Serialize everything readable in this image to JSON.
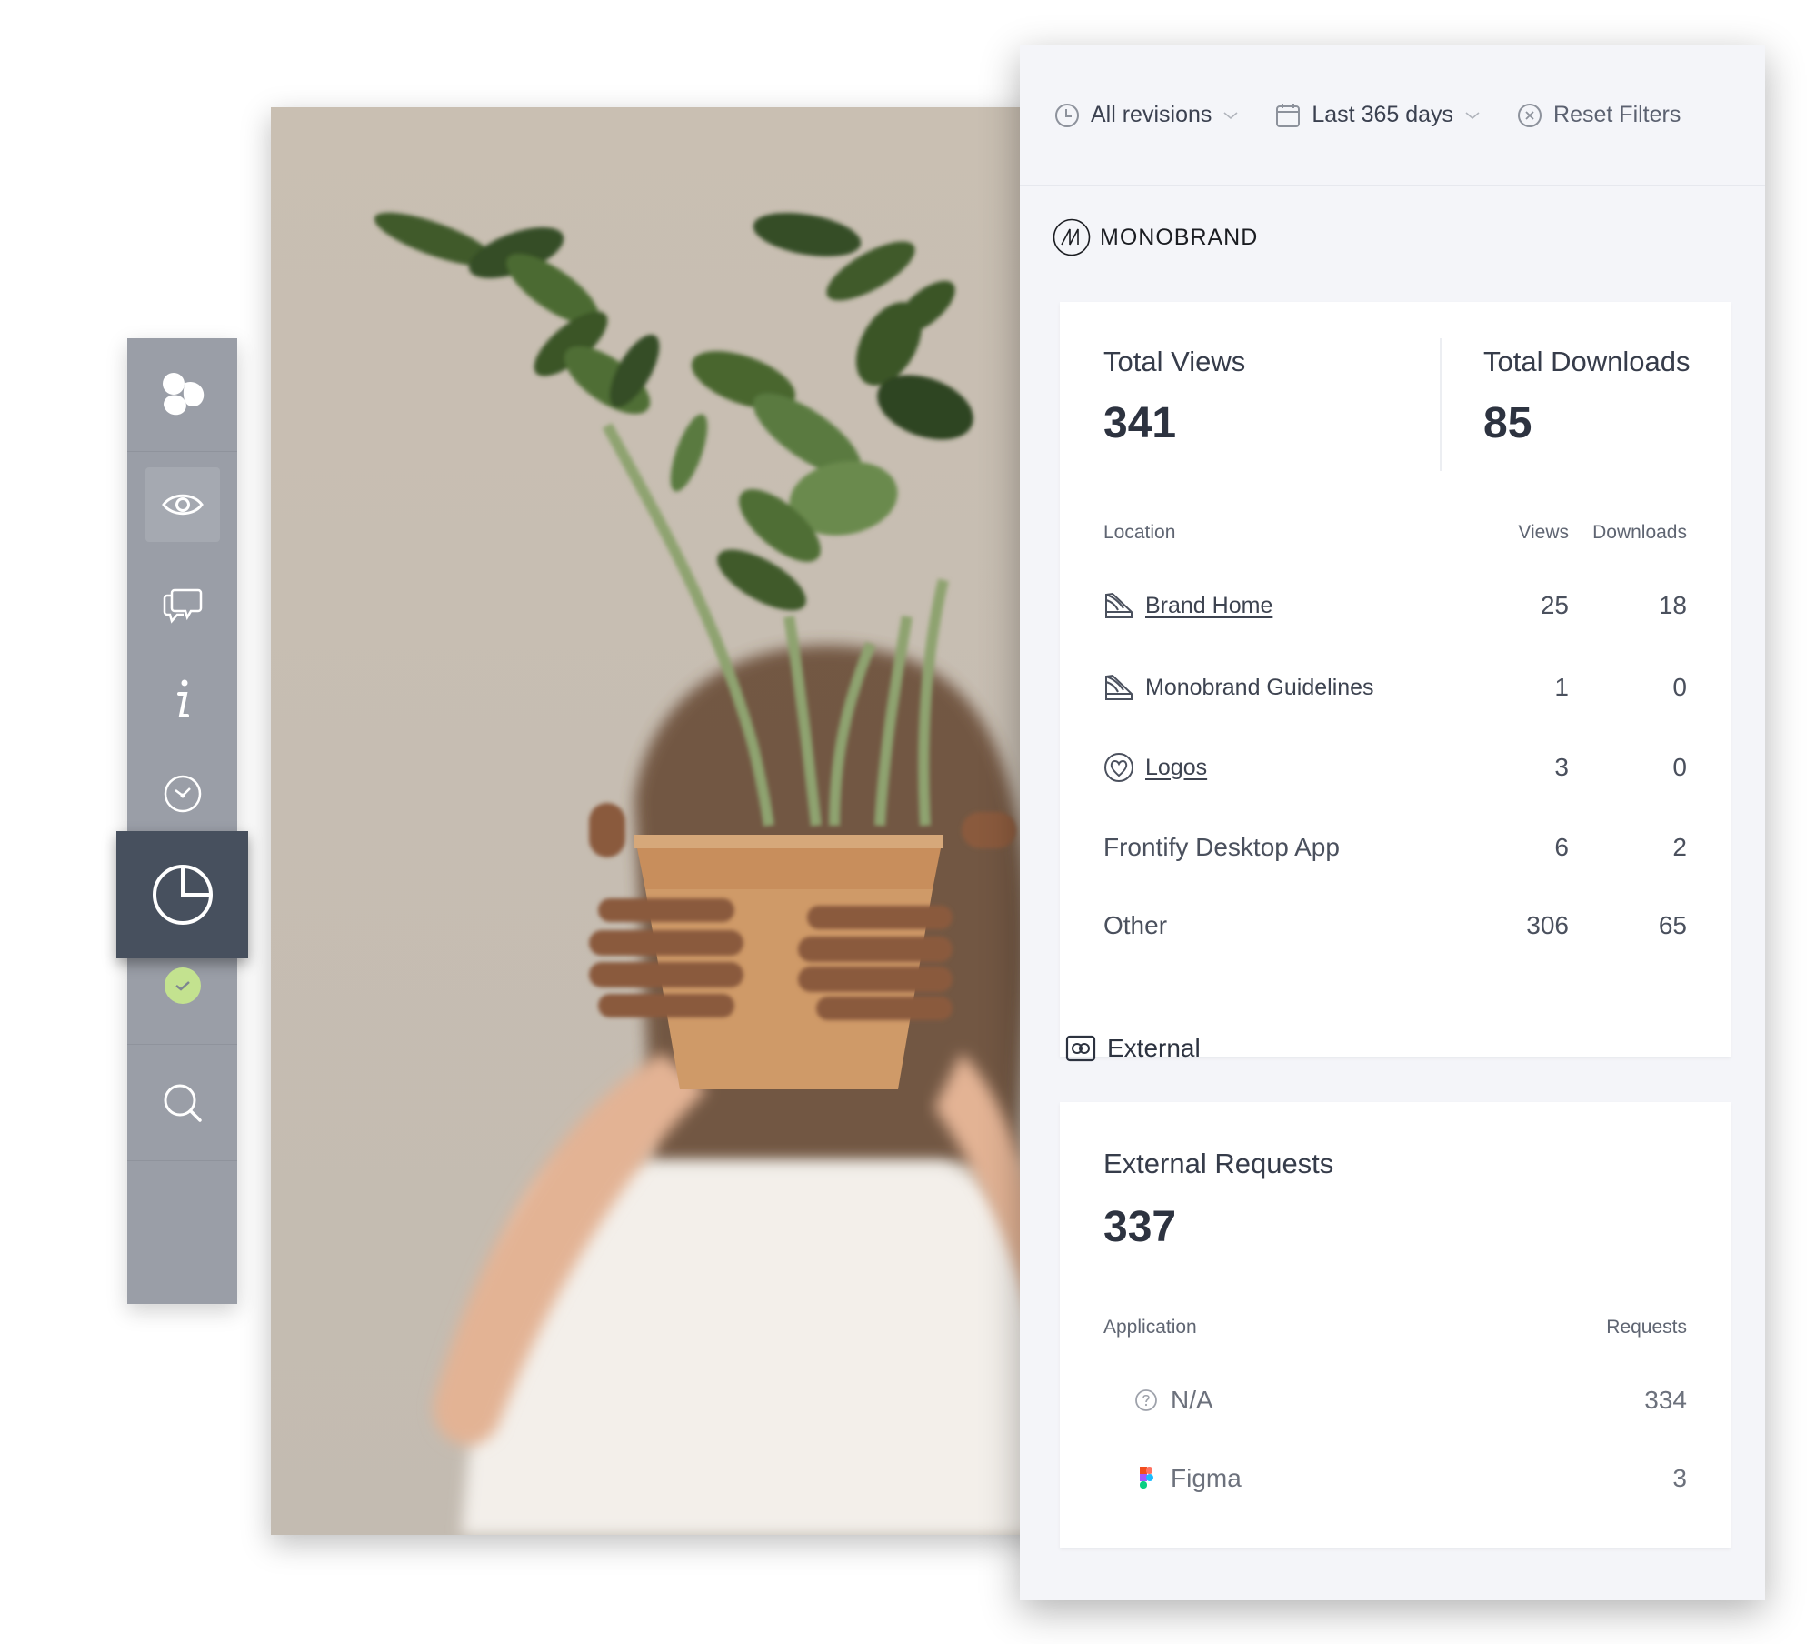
{
  "toolbar": {
    "items": [
      {
        "name": "logo",
        "icon": "frontify-logo-icon"
      },
      {
        "name": "view",
        "icon": "eye-icon",
        "state": "hover"
      },
      {
        "name": "comments",
        "icon": "comments-icon"
      },
      {
        "name": "info",
        "icon": "info-icon"
      },
      {
        "name": "history",
        "icon": "clock-icon"
      },
      {
        "name": "analytics",
        "icon": "pie-chart-icon",
        "state": "active"
      },
      {
        "name": "status",
        "icon": "check-badge-icon"
      },
      {
        "name": "search",
        "icon": "search-icon"
      }
    ],
    "accent_active": "#47505e",
    "status_color": "#c3e28f"
  },
  "photo": {
    "description": "Person holding a potted ZZ plant in front of face",
    "icon": "image"
  },
  "filters": {
    "revisions": {
      "label": "All revisions",
      "icon": "clock-icon"
    },
    "date_range": {
      "label": "Last 365 days",
      "icon": "calendar-icon"
    },
    "reset": {
      "label": "Reset Filters",
      "icon": "close-circle-icon"
    }
  },
  "brand": {
    "name": "MONOBRAND",
    "mark": "M"
  },
  "summary": {
    "total_views_label": "Total Views",
    "total_views": "341",
    "total_downloads_label": "Total Downloads",
    "total_downloads": "85"
  },
  "locations": {
    "headers": {
      "location": "Location",
      "views": "Views",
      "downloads": "Downloads"
    },
    "rows": [
      {
        "name": "Brand Home",
        "icon": "guideline-icon",
        "link": true,
        "views": "25",
        "downloads": "18"
      },
      {
        "name": "Monobrand Guidelines",
        "icon": "guideline-icon",
        "link": false,
        "views": "1",
        "downloads": "0"
      },
      {
        "name": "Logos",
        "icon": "heart-badge-icon",
        "link": true,
        "views": "3",
        "downloads": "0"
      },
      {
        "name": "Frontify Desktop App",
        "icon": "",
        "link": false,
        "views": "6",
        "downloads": "2"
      },
      {
        "name": "Other",
        "icon": "",
        "link": false,
        "views": "306",
        "downloads": "65"
      }
    ]
  },
  "external": {
    "section_label": "External",
    "requests_label": "External Requests",
    "requests_total": "337",
    "headers": {
      "application": "Application",
      "requests": "Requests"
    },
    "rows": [
      {
        "name": "N/A",
        "icon": "question-circle-icon",
        "requests": "334"
      },
      {
        "name": "Figma",
        "icon": "figma-icon",
        "requests": "3"
      }
    ]
  }
}
